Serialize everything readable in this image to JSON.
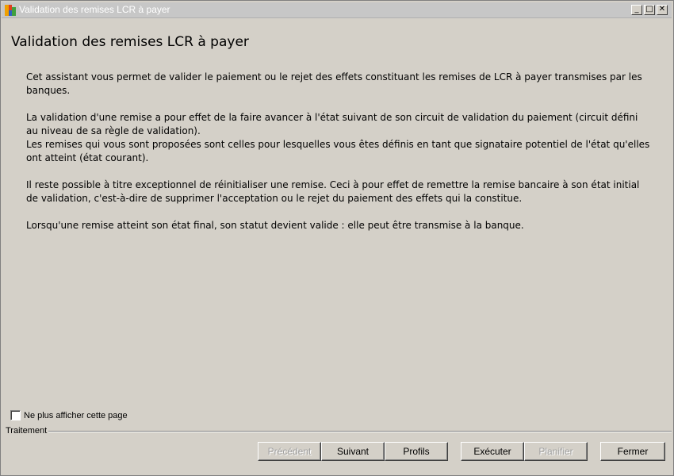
{
  "window": {
    "title": "Validation des remises LCR à payer",
    "controls": {
      "minimize": "_",
      "maximize": "□",
      "close": "✕"
    }
  },
  "page": {
    "title": "Validation des remises LCR à payer",
    "paragraphs": [
      "Cet assistant vous permet de valider le paiement ou le rejet des effets constituant les remises de LCR à payer transmises par les banques.",
      "La validation d'une remise a pour effet de la faire avancer à l'état suivant de son circuit de validation du paiement (circuit défini au niveau de sa règle de validation).",
      "Les remises qui vous sont proposées sont celles pour lesquelles vous êtes définis en tant que signataire potentiel de l'état qu'elles ont atteint (état courant).",
      "Il reste possible à titre exceptionnel de réinitialiser une remise. Ceci à pour effet de remettre la remise bancaire à son état initial de validation, c'est-à-dire de supprimer l'acceptation ou le rejet du paiement des effets qui la constitue.",
      "Lorsqu'une remise atteint son état final, son statut devient valide : elle peut être transmise à la banque."
    ]
  },
  "footer": {
    "checkbox_label": "Ne plus afficher cette page",
    "checkbox_checked": false,
    "group_label": "Traitement",
    "buttons": {
      "previous": "Précédent",
      "next": "Suivant",
      "profiles": "Profils",
      "execute": "Exécuter",
      "plan": "Planifier",
      "close": "Fermer"
    }
  },
  "colors": {
    "background": "#d4d0c8",
    "titlebar": "#c7c7c7",
    "disabled_text": "#a0a0a0"
  }
}
